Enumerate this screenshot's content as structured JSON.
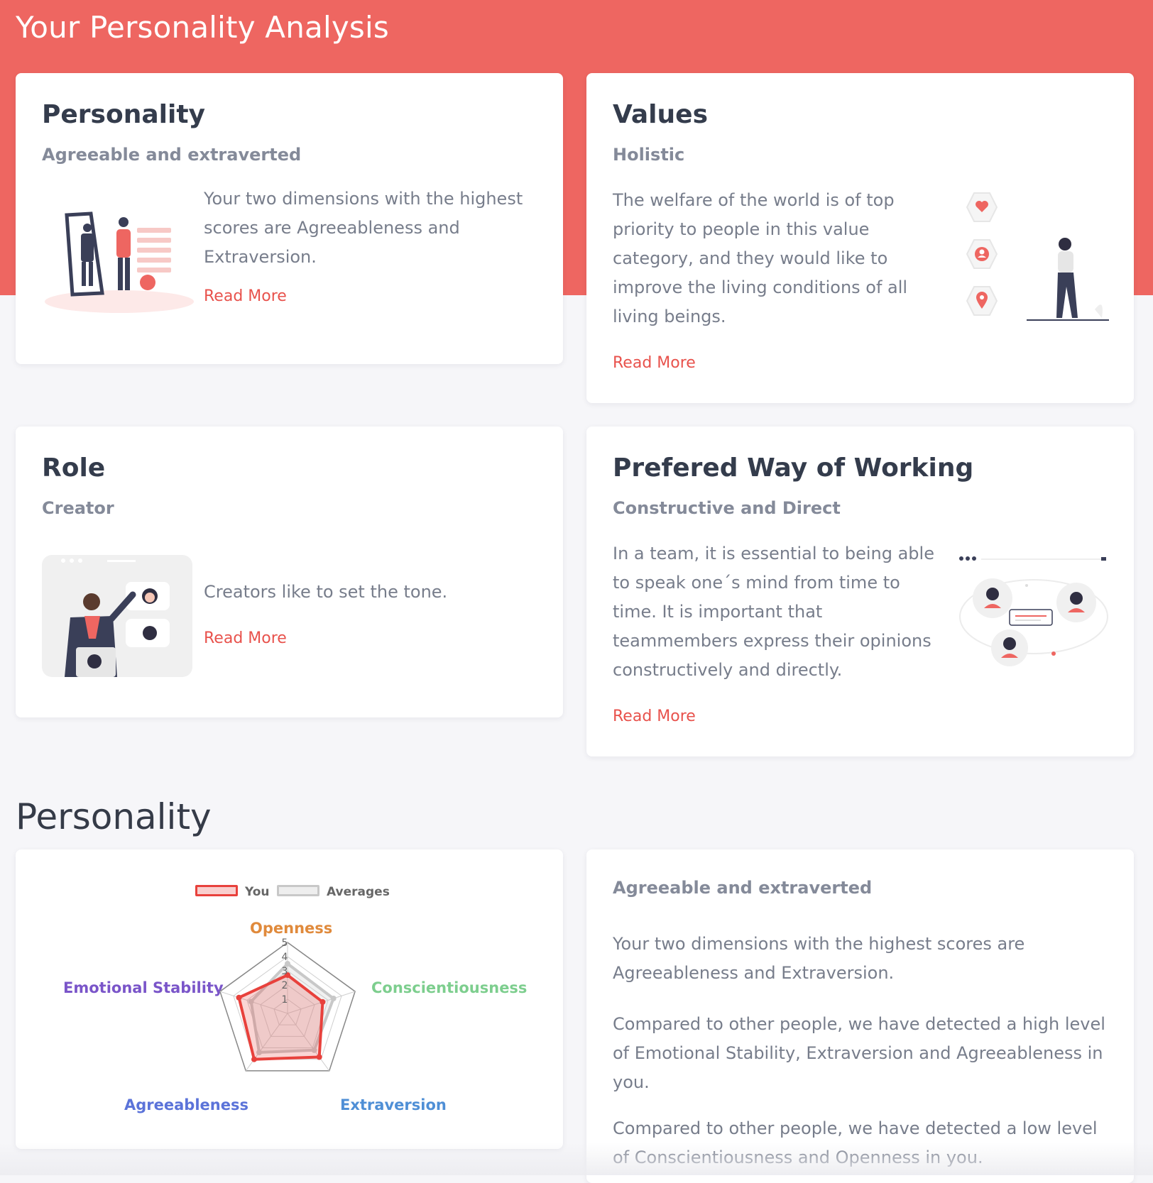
{
  "page": {
    "title": "Your Personality Analysis"
  },
  "cards": {
    "personality": {
      "title": "Personality",
      "subtitle": "Agreeable and extraverted",
      "body": "Your two dimensions with the highest scores are Agreeableness and Extraversion.",
      "link": "Read More"
    },
    "values": {
      "title": "Values",
      "subtitle": "Holistic",
      "body": "The welfare of the world is of top priority to people in this value category, and they would like to improve the living conditions of all living beings.",
      "link": "Read More"
    },
    "role": {
      "title": "Role",
      "subtitle": "Creator",
      "body": "Creators like to set the tone.",
      "link": "Read More"
    },
    "working": {
      "title": "Prefered Way of Working",
      "subtitle": "Constructive and Direct",
      "body": "In a team, it is essential to being able to speak one´s mind from time to time. It is important that teammembers express their opinions constructively and directly.",
      "link": "Read More"
    }
  },
  "section": {
    "heading": "Personality"
  },
  "summary": {
    "subtitle": "Agreeable and extraverted",
    "paragraphs": [
      "Your two dimensions with the highest scores are Agreeableness and Extraversion.",
      "Compared to other people, we have detected a high level of Emotional Stability, Extraversion and Agreeableness in you.",
      "Compared to other people, we have detected a low level of Conscientiousness and Openness in you."
    ]
  },
  "colors": {
    "accent": "#ee6661",
    "link": "#e8524c",
    "you_series": "#e8413c",
    "avg_series": "#c8c8c8",
    "openness": "#e08a3c",
    "conscientiousness": "#7dce8e",
    "extraversion": "#4f8fd6",
    "agreeableness": "#5b73d9",
    "emotional_stability": "#7a55c9"
  },
  "icons": [
    "heart-icon",
    "user-icon",
    "location-pin-icon"
  ],
  "chart_data": {
    "type": "radar",
    "categories": [
      "Openness",
      "Conscientiousness",
      "Extraversion",
      "Agreeableness",
      "Emotional Stability"
    ],
    "series": [
      {
        "name": "You",
        "values": [
          2.7,
          2.6,
          3.8,
          4.0,
          3.6
        ]
      },
      {
        "name": "Averages",
        "values": [
          3.5,
          3.4,
          3.2,
          3.4,
          2.7
        ]
      }
    ],
    "scale": {
      "min": 0,
      "max": 5,
      "ticks": [
        1,
        2,
        3,
        4,
        5
      ]
    },
    "legend": "top"
  }
}
